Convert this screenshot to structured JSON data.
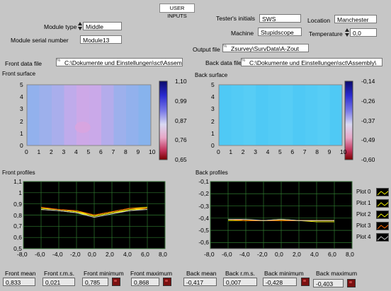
{
  "header": {
    "title": "USER INPUTS"
  },
  "inputs": {
    "module_type": {
      "label": "Module type",
      "value": "Middle"
    },
    "module_serial": {
      "label": "Module serial number",
      "value": "Module13"
    },
    "front_data_file": {
      "label": "Front data file",
      "value": "C:\\Dokumente und Einstellungen\\sct\\Assembly\\"
    },
    "tester_initials": {
      "label": "Tester's initials",
      "value": "SWS"
    },
    "machine": {
      "label": "Machine",
      "value": "Stupidscope"
    },
    "location": {
      "label": "Location",
      "value": "Manchester"
    },
    "temperature": {
      "label": "Temperature",
      "value": "0,0"
    },
    "output_file": {
      "label": "Output file",
      "value": "Zsurvey\\SurvData\\A-Zout"
    },
    "back_data_file": {
      "label": "Back data file",
      "value": "C:\\Dokumente und Einstellungen\\sct\\Assembly\\"
    }
  },
  "front_surface": {
    "title": "Front surface",
    "x_ticks": [
      "0",
      "1",
      "2",
      "3",
      "4",
      "5",
      "6",
      "7",
      "8",
      "9",
      "10"
    ],
    "y_ticks": [
      "0",
      "1",
      "2",
      "3",
      "4",
      "5"
    ],
    "scale_ticks": [
      "1,10",
      "0,99",
      "0,87",
      "0,76",
      "0,65"
    ]
  },
  "back_surface": {
    "title": "Back surface",
    "x_ticks": [
      "0",
      "1",
      "2",
      "3",
      "4",
      "5",
      "6",
      "7",
      "8",
      "9",
      "10"
    ],
    "y_ticks": [
      "0",
      "1",
      "2",
      "3",
      "4",
      "5"
    ],
    "scale_ticks": [
      "-0,14",
      "-0,26",
      "-0,37",
      "-0,49",
      "-0,60"
    ]
  },
  "front_profiles": {
    "title": "Front profiles",
    "x_ticks": [
      "-8,0",
      "-6,0",
      "-4,0",
      "-2,0",
      "0,0",
      "2,0",
      "4,0",
      "6,0",
      "8,0"
    ],
    "y_ticks": [
      "1,1",
      "1",
      "0,9",
      "0,8",
      "0,7",
      "0,6",
      "0,5"
    ]
  },
  "back_profiles": {
    "title": "Back profiles",
    "x_ticks": [
      "-8,0",
      "-6,0",
      "-4,0",
      "-2,0",
      "0,0",
      "2,0",
      "4,0",
      "6,0",
      "8,0"
    ],
    "y_ticks": [
      "-0,1",
      "-0,2",
      "-0,3",
      "-0,4",
      "-0,5",
      "-0,6"
    ]
  },
  "legend": [
    {
      "label": "Plot 0",
      "color": "#f0f000"
    },
    {
      "label": "Plot 1",
      "color": "#f0f000"
    },
    {
      "label": "Plot 2",
      "color": "#f0f000"
    },
    {
      "label": "Plot 3",
      "color": "#ff6a00"
    },
    {
      "label": "Plot 4",
      "color": "#c8c8c8"
    }
  ],
  "stats": {
    "front_mean": {
      "label": "Front mean",
      "value": "0,833"
    },
    "front_rms": {
      "label": "Front r.m.s.",
      "value": "0,021"
    },
    "front_min": {
      "label": "Front minimum",
      "value": "0,785"
    },
    "front_max": {
      "label": "Front maximum",
      "value": "0,868"
    },
    "back_mean": {
      "label": "Back mean",
      "value": "-0,417"
    },
    "back_rms": {
      "label": "Back r.m.s.",
      "value": "0,007"
    },
    "back_min": {
      "label": "Back minimum",
      "value": "-0,428"
    },
    "back_max": {
      "label": "Back maximum",
      "value": "-0,403"
    }
  },
  "colors": {
    "panel_bg": "#c6c6c6",
    "plot_bg": "#000000",
    "grid": "#2f7a2f",
    "front_map_base": "#17c4f2",
    "back_map_base": "#4fc9f5"
  },
  "chart_data": [
    {
      "type": "heatmap",
      "title": "Front surface",
      "xlim": [
        0,
        10
      ],
      "ylim": [
        0,
        5
      ],
      "color_range": [
        0.65,
        1.1
      ],
      "columns_approx": [
        0.99,
        0.98,
        0.97,
        0.95,
        0.9,
        0.92,
        0.96,
        0.98,
        0.99,
        1.0
      ],
      "note_low": [
        4.5,
        1.5,
        0.8
      ]
    },
    {
      "type": "heatmap",
      "title": "Back surface",
      "xlim": [
        0,
        10
      ],
      "ylim": [
        0,
        5
      ],
      "color_range": [
        -0.6,
        -0.14
      ],
      "columns_approx": [
        -0.26,
        -0.26,
        -0.26,
        -0.27,
        -0.27,
        -0.26,
        -0.26,
        -0.26,
        -0.26,
        -0.26
      ]
    },
    {
      "type": "line",
      "title": "Front profiles",
      "xlim": [
        -8,
        8
      ],
      "ylim": [
        0.5,
        1.1
      ],
      "series": [
        {
          "name": "Plot 0",
          "x": [
            -6,
            -4,
            -2,
            -0.5,
            0,
            2,
            4,
            6
          ],
          "y": [
            0.86,
            0.85,
            0.83,
            0.8,
            0.79,
            0.82,
            0.85,
            0.86
          ]
        },
        {
          "name": "Plot 1",
          "x": [
            -6,
            -4,
            -2,
            -0.5,
            0,
            2,
            4,
            6
          ],
          "y": [
            0.85,
            0.84,
            0.82,
            0.8,
            0.79,
            0.82,
            0.84,
            0.86
          ]
        },
        {
          "name": "Plot 2",
          "x": [
            -6,
            -4,
            -2,
            -0.5,
            0,
            2,
            4,
            6
          ],
          "y": [
            0.86,
            0.85,
            0.83,
            0.81,
            0.8,
            0.83,
            0.86,
            0.87
          ]
        },
        {
          "name": "Plot 3",
          "x": [
            -6,
            -4,
            -2,
            -0.5,
            0,
            2,
            4,
            6
          ],
          "y": [
            0.87,
            0.85,
            0.84,
            0.81,
            0.8,
            0.83,
            0.86,
            0.86
          ]
        },
        {
          "name": "Plot 4",
          "x": [
            -6,
            -4,
            -2,
            -0.5,
            0,
            2,
            4,
            6
          ],
          "y": [
            0.85,
            0.84,
            0.82,
            0.79,
            0.78,
            0.81,
            0.84,
            0.85
          ]
        }
      ]
    },
    {
      "type": "line",
      "title": "Back profiles",
      "xlim": [
        -8,
        8
      ],
      "ylim": [
        -0.65,
        -0.1
      ],
      "series": [
        {
          "name": "Plot 0",
          "x": [
            -6,
            -4,
            -2,
            0,
            2,
            4,
            6
          ],
          "y": [
            -0.41,
            -0.42,
            -0.42,
            -0.42,
            -0.42,
            -0.42,
            -0.42
          ]
        },
        {
          "name": "Plot 1",
          "x": [
            -6,
            -4,
            -2,
            0,
            2,
            4,
            6
          ],
          "y": [
            -0.41,
            -0.42,
            -0.42,
            -0.41,
            -0.42,
            -0.42,
            -0.42
          ]
        },
        {
          "name": "Plot 2",
          "x": [
            -6,
            -4,
            -2,
            0,
            2,
            4,
            6
          ],
          "y": [
            -0.42,
            -0.42,
            -0.42,
            -0.42,
            -0.42,
            -0.43,
            -0.43
          ]
        },
        {
          "name": "Plot 3",
          "x": [
            -6,
            -4,
            -2,
            0,
            2,
            4,
            6
          ],
          "y": [
            -0.41,
            -0.42,
            -0.42,
            -0.42,
            -0.42,
            -0.42,
            -0.42
          ]
        },
        {
          "name": "Plot 4",
          "x": [
            -6,
            -4,
            -2,
            0,
            2,
            4,
            6
          ],
          "y": [
            -0.41,
            -0.41,
            -0.42,
            -0.41,
            -0.42,
            -0.42,
            -0.42
          ]
        }
      ]
    }
  ]
}
